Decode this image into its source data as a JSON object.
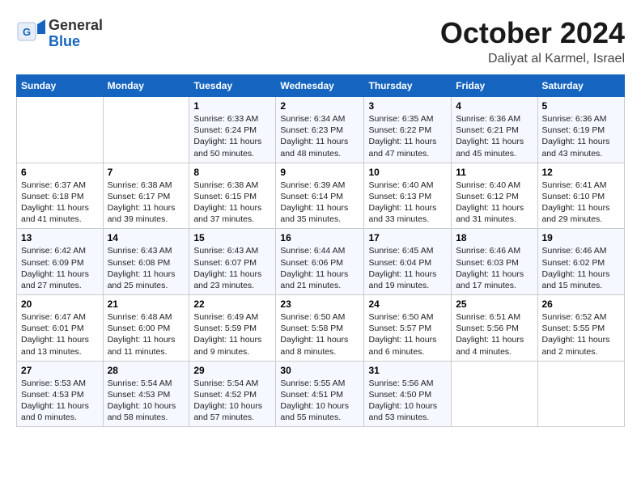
{
  "header": {
    "logo_general": "General",
    "logo_blue": "Blue",
    "month": "October 2024",
    "location": "Daliyat al Karmel, Israel"
  },
  "columns": [
    "Sunday",
    "Monday",
    "Tuesday",
    "Wednesday",
    "Thursday",
    "Friday",
    "Saturday"
  ],
  "weeks": [
    [
      {
        "day": "",
        "info": ""
      },
      {
        "day": "",
        "info": ""
      },
      {
        "day": "1",
        "info": "Sunrise: 6:33 AM\nSunset: 6:24 PM\nDaylight: 11 hours and 50 minutes."
      },
      {
        "day": "2",
        "info": "Sunrise: 6:34 AM\nSunset: 6:23 PM\nDaylight: 11 hours and 48 minutes."
      },
      {
        "day": "3",
        "info": "Sunrise: 6:35 AM\nSunset: 6:22 PM\nDaylight: 11 hours and 47 minutes."
      },
      {
        "day": "4",
        "info": "Sunrise: 6:36 AM\nSunset: 6:21 PM\nDaylight: 11 hours and 45 minutes."
      },
      {
        "day": "5",
        "info": "Sunrise: 6:36 AM\nSunset: 6:19 PM\nDaylight: 11 hours and 43 minutes."
      }
    ],
    [
      {
        "day": "6",
        "info": "Sunrise: 6:37 AM\nSunset: 6:18 PM\nDaylight: 11 hours and 41 minutes."
      },
      {
        "day": "7",
        "info": "Sunrise: 6:38 AM\nSunset: 6:17 PM\nDaylight: 11 hours and 39 minutes."
      },
      {
        "day": "8",
        "info": "Sunrise: 6:38 AM\nSunset: 6:15 PM\nDaylight: 11 hours and 37 minutes."
      },
      {
        "day": "9",
        "info": "Sunrise: 6:39 AM\nSunset: 6:14 PM\nDaylight: 11 hours and 35 minutes."
      },
      {
        "day": "10",
        "info": "Sunrise: 6:40 AM\nSunset: 6:13 PM\nDaylight: 11 hours and 33 minutes."
      },
      {
        "day": "11",
        "info": "Sunrise: 6:40 AM\nSunset: 6:12 PM\nDaylight: 11 hours and 31 minutes."
      },
      {
        "day": "12",
        "info": "Sunrise: 6:41 AM\nSunset: 6:10 PM\nDaylight: 11 hours and 29 minutes."
      }
    ],
    [
      {
        "day": "13",
        "info": "Sunrise: 6:42 AM\nSunset: 6:09 PM\nDaylight: 11 hours and 27 minutes."
      },
      {
        "day": "14",
        "info": "Sunrise: 6:43 AM\nSunset: 6:08 PM\nDaylight: 11 hours and 25 minutes."
      },
      {
        "day": "15",
        "info": "Sunrise: 6:43 AM\nSunset: 6:07 PM\nDaylight: 11 hours and 23 minutes."
      },
      {
        "day": "16",
        "info": "Sunrise: 6:44 AM\nSunset: 6:06 PM\nDaylight: 11 hours and 21 minutes."
      },
      {
        "day": "17",
        "info": "Sunrise: 6:45 AM\nSunset: 6:04 PM\nDaylight: 11 hours and 19 minutes."
      },
      {
        "day": "18",
        "info": "Sunrise: 6:46 AM\nSunset: 6:03 PM\nDaylight: 11 hours and 17 minutes."
      },
      {
        "day": "19",
        "info": "Sunrise: 6:46 AM\nSunset: 6:02 PM\nDaylight: 11 hours and 15 minutes."
      }
    ],
    [
      {
        "day": "20",
        "info": "Sunrise: 6:47 AM\nSunset: 6:01 PM\nDaylight: 11 hours and 13 minutes."
      },
      {
        "day": "21",
        "info": "Sunrise: 6:48 AM\nSunset: 6:00 PM\nDaylight: 11 hours and 11 minutes."
      },
      {
        "day": "22",
        "info": "Sunrise: 6:49 AM\nSunset: 5:59 PM\nDaylight: 11 hours and 9 minutes."
      },
      {
        "day": "23",
        "info": "Sunrise: 6:50 AM\nSunset: 5:58 PM\nDaylight: 11 hours and 8 minutes."
      },
      {
        "day": "24",
        "info": "Sunrise: 6:50 AM\nSunset: 5:57 PM\nDaylight: 11 hours and 6 minutes."
      },
      {
        "day": "25",
        "info": "Sunrise: 6:51 AM\nSunset: 5:56 PM\nDaylight: 11 hours and 4 minutes."
      },
      {
        "day": "26",
        "info": "Sunrise: 6:52 AM\nSunset: 5:55 PM\nDaylight: 11 hours and 2 minutes."
      }
    ],
    [
      {
        "day": "27",
        "info": "Sunrise: 5:53 AM\nSunset: 4:53 PM\nDaylight: 11 hours and 0 minutes."
      },
      {
        "day": "28",
        "info": "Sunrise: 5:54 AM\nSunset: 4:53 PM\nDaylight: 10 hours and 58 minutes."
      },
      {
        "day": "29",
        "info": "Sunrise: 5:54 AM\nSunset: 4:52 PM\nDaylight: 10 hours and 57 minutes."
      },
      {
        "day": "30",
        "info": "Sunrise: 5:55 AM\nSunset: 4:51 PM\nDaylight: 10 hours and 55 minutes."
      },
      {
        "day": "31",
        "info": "Sunrise: 5:56 AM\nSunset: 4:50 PM\nDaylight: 10 hours and 53 minutes."
      },
      {
        "day": "",
        "info": ""
      },
      {
        "day": "",
        "info": ""
      }
    ]
  ]
}
